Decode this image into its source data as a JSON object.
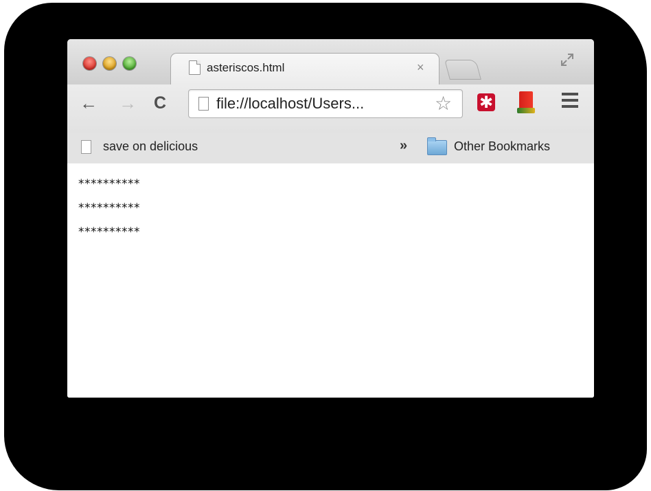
{
  "tab": {
    "title": "asteriscos.html",
    "close_glyph": "×"
  },
  "toolbar": {
    "back_glyph": "←",
    "forward_glyph": "→",
    "reload_glyph": "C",
    "url": "file://localhost/Users...",
    "star_glyph": "☆",
    "lastpass_glyph": "✱"
  },
  "bookmarks": {
    "item_label": "save on delicious",
    "overflow_glyph": "»",
    "other_label": "Other Bookmarks"
  },
  "content": {
    "lines": [
      "**********",
      "**********",
      "**********"
    ]
  },
  "icons": {
    "tab_icon": "document-icon",
    "url_icon": "document-icon",
    "bookmark_icon": "document-icon",
    "folder_icon": "folder-icon",
    "star_icon": "star-icon",
    "menu_icon": "hamburger-menu-icon",
    "fullscreen_icon": "fullscreen-icon",
    "extension_1": "lastpass-icon",
    "extension_2": "book-icon"
  },
  "colors": {
    "close": "#d8322a",
    "minimize": "#d99c18",
    "zoom": "#4aa82e",
    "lastpass": "#c8102e"
  }
}
